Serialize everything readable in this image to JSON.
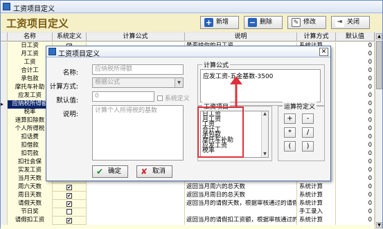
{
  "window": {
    "title": "工资项目定义"
  },
  "header": {
    "page_title": "工资项目定义",
    "buttons": [
      {
        "label": "新增",
        "icon": "plus-icon"
      },
      {
        "label": "删除",
        "icon": "minus-icon"
      },
      {
        "label": "修改",
        "icon": "edit-icon"
      },
      {
        "label": "关闭",
        "icon": "close-icon"
      }
    ]
  },
  "grid": {
    "columns": [
      "名称",
      "系统定义",
      "计算公式",
      "说明",
      "计算方式",
      "默认值"
    ],
    "rows": [
      {
        "name": "日工资",
        "sys": true,
        "desc": "是否给你的日工资",
        "method": "系统计算",
        "default": "0"
      },
      {
        "name": "月工资",
        "sys": false,
        "desc": "",
        "method": "",
        "default": "0"
      },
      {
        "name": "工资",
        "sys": false,
        "desc": "",
        "method": "",
        "default": "0"
      },
      {
        "name": "合计工",
        "sys": false,
        "desc": "",
        "method": "",
        "default": "0"
      },
      {
        "name": "承包款",
        "sys": false,
        "desc": "",
        "method": "",
        "default": "0"
      },
      {
        "name": "摩托车补助",
        "sys": false,
        "desc": "",
        "method": "",
        "default": "0"
      },
      {
        "name": "应发工资",
        "sys": false,
        "desc": "",
        "method": "",
        "default": "0"
      },
      {
        "name": "应纳税所得额",
        "sys": false,
        "desc": "",
        "method": "",
        "default": "0",
        "selected": true
      },
      {
        "name": "税率",
        "sys": false,
        "desc": "",
        "method": "",
        "default": "0"
      },
      {
        "name": "速算扣除数",
        "sys": false,
        "desc": "",
        "method": "",
        "default": "0"
      },
      {
        "name": "个人所得税",
        "sys": false,
        "desc": "",
        "method": "",
        "default": "0"
      },
      {
        "name": "扣话费",
        "sys": false,
        "desc": "",
        "method": "",
        "default": "0"
      },
      {
        "name": "扣借款",
        "sys": false,
        "desc": "",
        "method": "",
        "default": "0"
      },
      {
        "name": "扣罚款",
        "sys": false,
        "desc": "",
        "method": "",
        "default": "0"
      },
      {
        "name": "扣社会保",
        "sys": false,
        "desc": "",
        "method": "",
        "default": "0"
      },
      {
        "name": "实发工资",
        "sys": false,
        "desc": "",
        "method": "",
        "default": "0"
      },
      {
        "name": "当月天数",
        "sys": false,
        "desc": "",
        "method": "",
        "default": "0"
      },
      {
        "name": "周六天数",
        "sys": true,
        "desc": "返回当月周六的总天数",
        "method": "系统计算",
        "default": "0"
      },
      {
        "name": "周日天数",
        "sys": true,
        "desc": "返回当月周日的总天数",
        "method": "系统计算",
        "default": "0"
      },
      {
        "name": "请假天数",
        "sys": true,
        "desc": "返回当月的请假天数，根据审核通过的请假单计算",
        "method": "系统计算",
        "default": "0"
      },
      {
        "name": "节日奖",
        "sys": false,
        "desc": "",
        "method": "手工录入",
        "default": "0"
      },
      {
        "name": "请假扣工资",
        "sys": true,
        "desc": "返回当月的请假扣工资额，根据审核通过的请假单计算",
        "method": "系统计算",
        "default": "0"
      }
    ]
  },
  "dialog": {
    "title": "工资项目定义",
    "name_label": "名称:",
    "name_value": "应纳税所得额",
    "method_label": "计算方式:",
    "method_value": "根据公式",
    "default_label": "默认值:",
    "default_value": "0",
    "sys_label": "系统定义",
    "desc_label": "说明:",
    "desc_value": "计算个人所得税的基数",
    "formula_legend": "计算公式",
    "formula_value": "应发工资-五金基数-3500",
    "items_legend": "工资项目",
    "items": [
      "日工资",
      "月工资",
      "工资",
      "合计工",
      "承包款",
      "摩托车补助",
      "应发工资",
      "税率"
    ],
    "ops_legend": "运算符定义",
    "ops": [
      "+",
      "-",
      "*",
      "/",
      "(",
      ")"
    ],
    "ok_label": "确定",
    "cancel_label": "取消"
  },
  "colors": {
    "annotation": "#e0303a",
    "header_bg": "#f5f0c8",
    "selected_row": "#0a246a"
  }
}
